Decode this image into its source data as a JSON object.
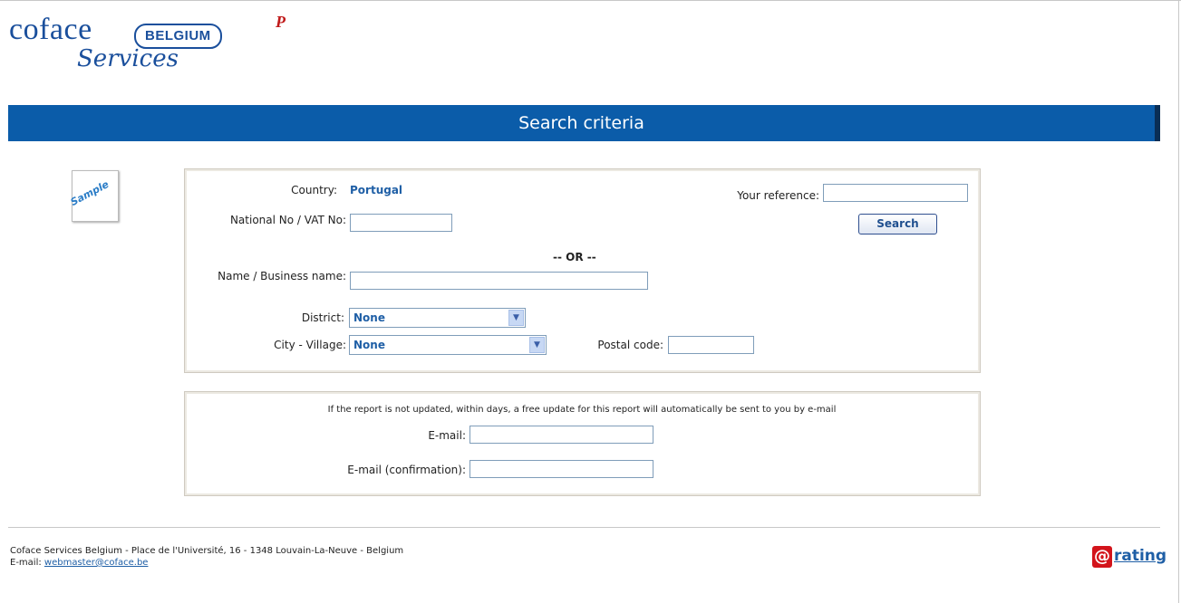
{
  "logo": {
    "brand": "coface",
    "country": "BELGIUM",
    "mark": "P",
    "subtitle": "Services"
  },
  "banner": {
    "title": "Search criteria"
  },
  "sample_badge": "Sample",
  "search_form": {
    "country_label": "Country:",
    "country_value": "Portugal",
    "national_no_label": "National No / VAT No:",
    "national_no_value": "",
    "or_label": "-- OR --",
    "name_label": "Name / Business name:",
    "name_value": "",
    "district_label": "District:",
    "district_selected": "None",
    "city_label": "City - Village:",
    "city_selected": "None",
    "postal_code_label": "Postal code:",
    "postal_code_value": "",
    "reference_label": "Your reference:",
    "reference_value": "",
    "search_button": "Search"
  },
  "email_form": {
    "notice": "If the report is not updated, within days, a free update for this report will automatically be sent to you by e-mail",
    "email_label": "E-mail:",
    "email_value": "",
    "email_confirm_label": "E-mail (confirmation):",
    "email_confirm_value": ""
  },
  "footer": {
    "address": "Coface Services Belgium - Place de l'Université, 16 - 1348 Louvain-La-Neuve - Belgium",
    "email_label": "E-mail:",
    "email_link": "webmaster@coface.be"
  },
  "rating_logo": {
    "at": "@",
    "word": "rating"
  },
  "colors": {
    "banner": "#0b5ca9",
    "accent": "#1f5fa6",
    "rating_red": "#d3141b"
  }
}
